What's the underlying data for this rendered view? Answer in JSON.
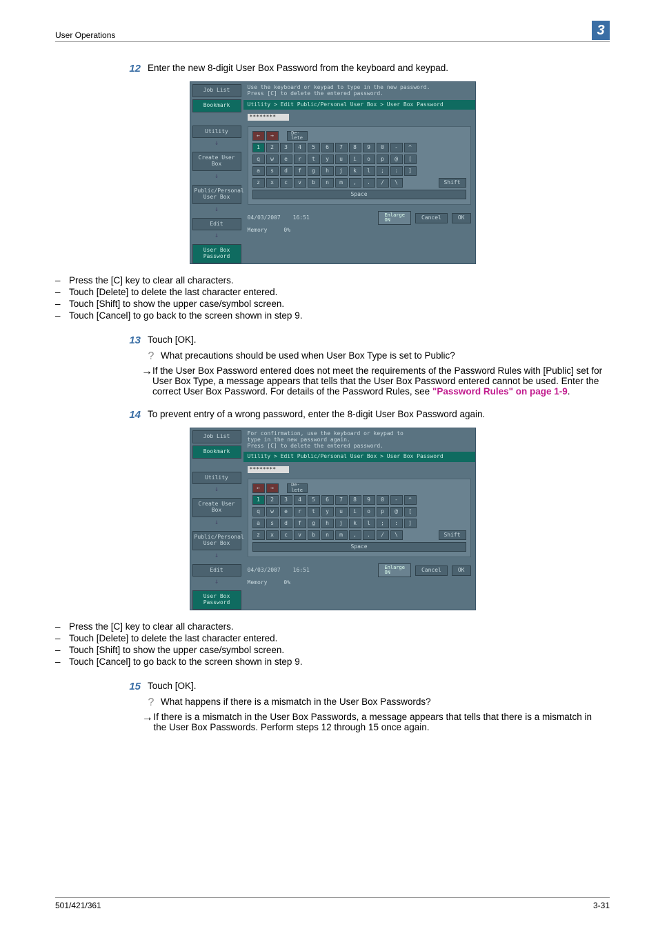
{
  "header": {
    "section": "User Operations",
    "chapter": "3"
  },
  "footer": {
    "model": "501/421/361",
    "page": "3-31"
  },
  "steps": {
    "s12": {
      "num": "12",
      "text": "Enter the new 8-digit User Box Password from the keyboard and keypad."
    },
    "s13": {
      "num": "13",
      "text": "Touch [OK]."
    },
    "s14": {
      "num": "14",
      "text": "To prevent entry of a wrong password, enter the 8-digit User Box Password again."
    },
    "s15": {
      "num": "15",
      "text": "Touch [OK]."
    }
  },
  "bullets_a": [
    "Press the [C] key to clear all characters.",
    "Touch [Delete] to delete the last character entered.",
    "Touch [Shift] to show the upper case/symbol screen.",
    "Touch [Cancel] to go back to the screen shown in step 9."
  ],
  "qa1": {
    "q": "What precautions should be used when User Box Type is set to Public?",
    "a": "If the User Box Password entered does not meet the requirements of the Password Rules with [Public] set for User Box Type, a message appears that tells that the User Box Password entered cannot be used. Enter the correct User Box Password. For details of the Password Rules, see ",
    "link": "\"Password Rules\" on page 1-9",
    "tail": "."
  },
  "bullets_b": [
    "Press the [C] key to clear all characters.",
    "Touch [Delete] to delete the last character entered.",
    "Touch [Shift] to show the upper case/symbol screen.",
    "Touch [Cancel] to go back to the screen shown in step 9."
  ],
  "qa2": {
    "q": "What happens if there is a mismatch in the User Box Passwords?",
    "a": "If there is a mismatch in the User Box Passwords, a message appears that tells that there is a mismatch in the User Box Passwords. Perform steps 12 through 15 once again."
  },
  "device": {
    "side": {
      "job_list": "Job List",
      "bookmark": "Bookmark",
      "utility": "Utility",
      "create": "Create User Box",
      "pubpers": "Public/Personal\nUser Box",
      "edit": "Edit",
      "ubpass": "User Box\nPassword"
    },
    "hdr1": "Use the keyboard or keypad to type in the new password.\nPress [C] to delete the entered password.",
    "hdr2": "For confirmation, use the keyboard or keypad to\ntype in the new password again.\nPress [C] to delete the entered password.",
    "breadcrumb": "Utility > Edit Public/Personal User Box > User Box Password",
    "pwmask": "********",
    "keys": {
      "delete": "De-\nlete",
      "row1": [
        "1",
        "2",
        "3",
        "4",
        "5",
        "6",
        "7",
        "8",
        "9",
        "0",
        "-",
        "^"
      ],
      "row2": [
        "q",
        "w",
        "e",
        "r",
        "t",
        "y",
        "u",
        "i",
        "o",
        "p",
        "@",
        "["
      ],
      "row3": [
        "a",
        "s",
        "d",
        "f",
        "g",
        "h",
        "j",
        "k",
        "l",
        ";",
        ":",
        "]"
      ],
      "row4": [
        "z",
        "x",
        "c",
        "v",
        "b",
        "n",
        "m",
        ",",
        ".",
        "/",
        "\\"
      ],
      "shift": "Shift",
      "space": "Space"
    },
    "status": {
      "date": "04/03/2007",
      "time": "16:51",
      "memlbl": "Memory",
      "mempct": "0%",
      "enlarge": "Enlarge\nON",
      "cancel": "Cancel",
      "ok": "OK"
    }
  }
}
